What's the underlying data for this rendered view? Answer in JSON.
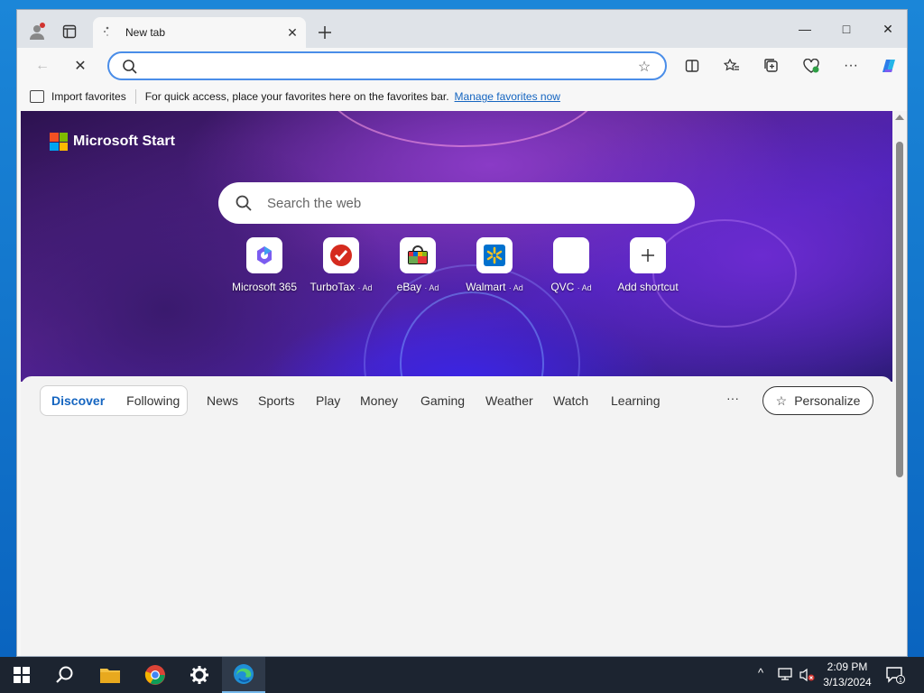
{
  "browser": {
    "tab": {
      "title": "New tab",
      "close_icon": "close-icon"
    },
    "new_tab_icon": "plus-icon",
    "window_controls": {
      "minimize": "—",
      "maximize": "□",
      "close": "✕"
    },
    "toolbar": {
      "back_icon": "←",
      "stop_icon": "✕",
      "address": {
        "value": "",
        "placeholder": ""
      },
      "favorite_icon": "☆"
    },
    "favorites_bar": {
      "import_label": "Import favorites",
      "message": "For quick access, place your favorites here on the favorites bar.",
      "manage_link": "Manage favorites now"
    }
  },
  "page": {
    "brand": "Microsoft Start",
    "search": {
      "placeholder": "Search the web"
    },
    "shortcuts": [
      {
        "label": "Microsoft 365",
        "ad": ""
      },
      {
        "label": "TurboTax",
        "ad": "· Ad"
      },
      {
        "label": "eBay",
        "ad": "· Ad"
      },
      {
        "label": "Walmart",
        "ad": "· Ad"
      },
      {
        "label": "QVC",
        "ad": "· Ad"
      },
      {
        "label": "Add shortcut",
        "ad": ""
      }
    ],
    "feed_tabs": {
      "discover": "Discover",
      "following": "Following"
    },
    "nav": [
      "News",
      "Sports",
      "Play",
      "Money",
      "Gaming",
      "Weather",
      "Watch",
      "Learning"
    ],
    "more": "···",
    "personalize": "Personalize"
  },
  "taskbar": {
    "clock": {
      "time": "2:09 PM",
      "date": "3/13/2024"
    },
    "notification_count": "1",
    "tray_chevron": "^"
  },
  "colors": {
    "accent": "#1565c0",
    "address_border": "#4a8de8",
    "taskbar": "#1c2430"
  }
}
